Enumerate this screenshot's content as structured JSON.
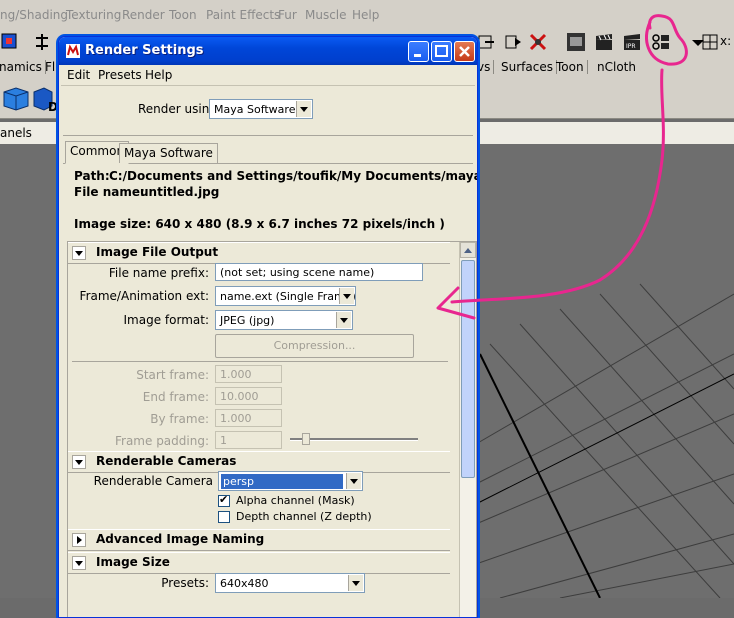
{
  "maya": {
    "menu": [
      "ng/Shading",
      "Texturing",
      "Render",
      "Toon",
      "Paint Effects",
      "Fur",
      "Muscle",
      "Help"
    ],
    "shelf_tabs_left": [
      "namics",
      "Fl"
    ],
    "shelf_tabs_right": [
      "vs",
      "Surfaces",
      "Toon",
      "nCloth"
    ],
    "panels_label": "anels",
    "shelf_letter": "D",
    "toolbar_right_label": "x:"
  },
  "dialog": {
    "title": "Render Settings",
    "menu": {
      "edit": "Edit",
      "presets": "Presets",
      "help": "Help"
    },
    "render_using_label": "Render using:",
    "render_using_value": "Maya Software",
    "tabs": [
      "Common",
      "Maya Software"
    ],
    "path_label": "Path:",
    "path_value": "C:/Documents and Settings/toufik/My Documents/maya/project",
    "file_name_label": "File name:",
    "file_name_value": "untitled.jpg",
    "image_size_text": "Image size: 640 x 480 (8.9 x 6.7 inches 72 pixels/inch )",
    "sections": {
      "image_file_output": {
        "title": "Image File Output",
        "file_name_prefix_label": "File name prefix:",
        "file_name_prefix_value": "(not set; using scene name)",
        "frame_anim_ext_label": "Frame/Animation ext:",
        "frame_anim_ext_value": "name.ext (Single Frame)",
        "image_format_label": "Image format:",
        "image_format_value": "JPEG (jpg)",
        "compression_label": "Compression...",
        "start_frame_label": "Start frame:",
        "start_frame_value": "1.000",
        "end_frame_label": "End frame:",
        "end_frame_value": "10.000",
        "by_frame_label": "By frame:",
        "by_frame_value": "1.000",
        "frame_padding_label": "Frame padding:",
        "frame_padding_value": "1"
      },
      "renderable_cameras": {
        "title": "Renderable Cameras",
        "camera_label": "Renderable Camera",
        "camera_value": "persp",
        "alpha_label": "Alpha channel (Mask)",
        "alpha_checked": true,
        "depth_label": "Depth channel (Z depth)",
        "depth_checked": false
      },
      "advanced_image_naming": {
        "title": "Advanced Image Naming"
      },
      "image_size": {
        "title": "Image Size",
        "presets_label": "Presets:",
        "presets_value": "640x480"
      }
    }
  },
  "colors": {
    "annotation": "#e8268f",
    "xp_title": "#0046d8"
  }
}
